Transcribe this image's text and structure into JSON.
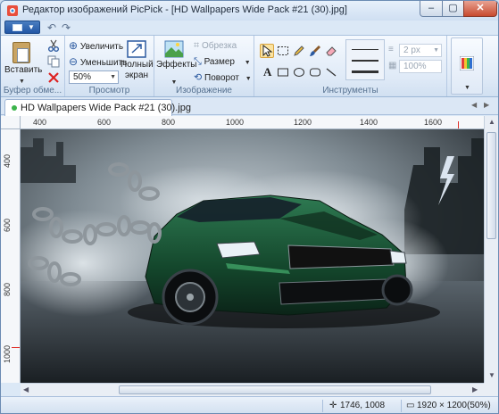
{
  "window": {
    "title": "Редактор изображений PicPick - [HD Wallpapers Wide Pack #21 (30).jpg]",
    "minimize_glyph": "–",
    "maximize_glyph": "▢",
    "close_glyph": "✕"
  },
  "quick_access": {
    "undo_icon": "undo-icon",
    "redo_icon": "redo-icon"
  },
  "ribbon": {
    "clipboard": {
      "group_label": "Буфер обме...",
      "paste_label": "Вставить"
    },
    "view": {
      "group_label": "Просмотр",
      "zoom_in_label": "Увеличить",
      "zoom_out_label": "Уменьшить",
      "zoom_value": "50%",
      "fullscreen_label_line1": "Полный",
      "fullscreen_label_line2": "экран"
    },
    "image": {
      "group_label": "Изображение",
      "effects_label": "Эффекты",
      "crop_label": "Обрезка",
      "resize_label": "Размер",
      "rotate_label": "Поворот"
    },
    "tools": {
      "group_label": "Инструменты",
      "stroke_width": "2 px",
      "opacity": "100%"
    }
  },
  "tabs": [
    {
      "label": "HD Wallpapers Wide Pack #21 (30).jpg"
    }
  ],
  "ruler": {
    "horizontal": [
      "400",
      "600",
      "800",
      "1000",
      "1200",
      "1400",
      "1600"
    ],
    "vertical": [
      "400",
      "600",
      "800",
      "1000"
    ]
  },
  "status": {
    "cursor": "1746, 1008",
    "dimensions": "1920 × 1200",
    "zoom": "(50%)"
  },
  "colors": {
    "accent": "#2257a6",
    "ribbon_bg": "#dfeaf7",
    "car_green": "#1f5a3a"
  }
}
